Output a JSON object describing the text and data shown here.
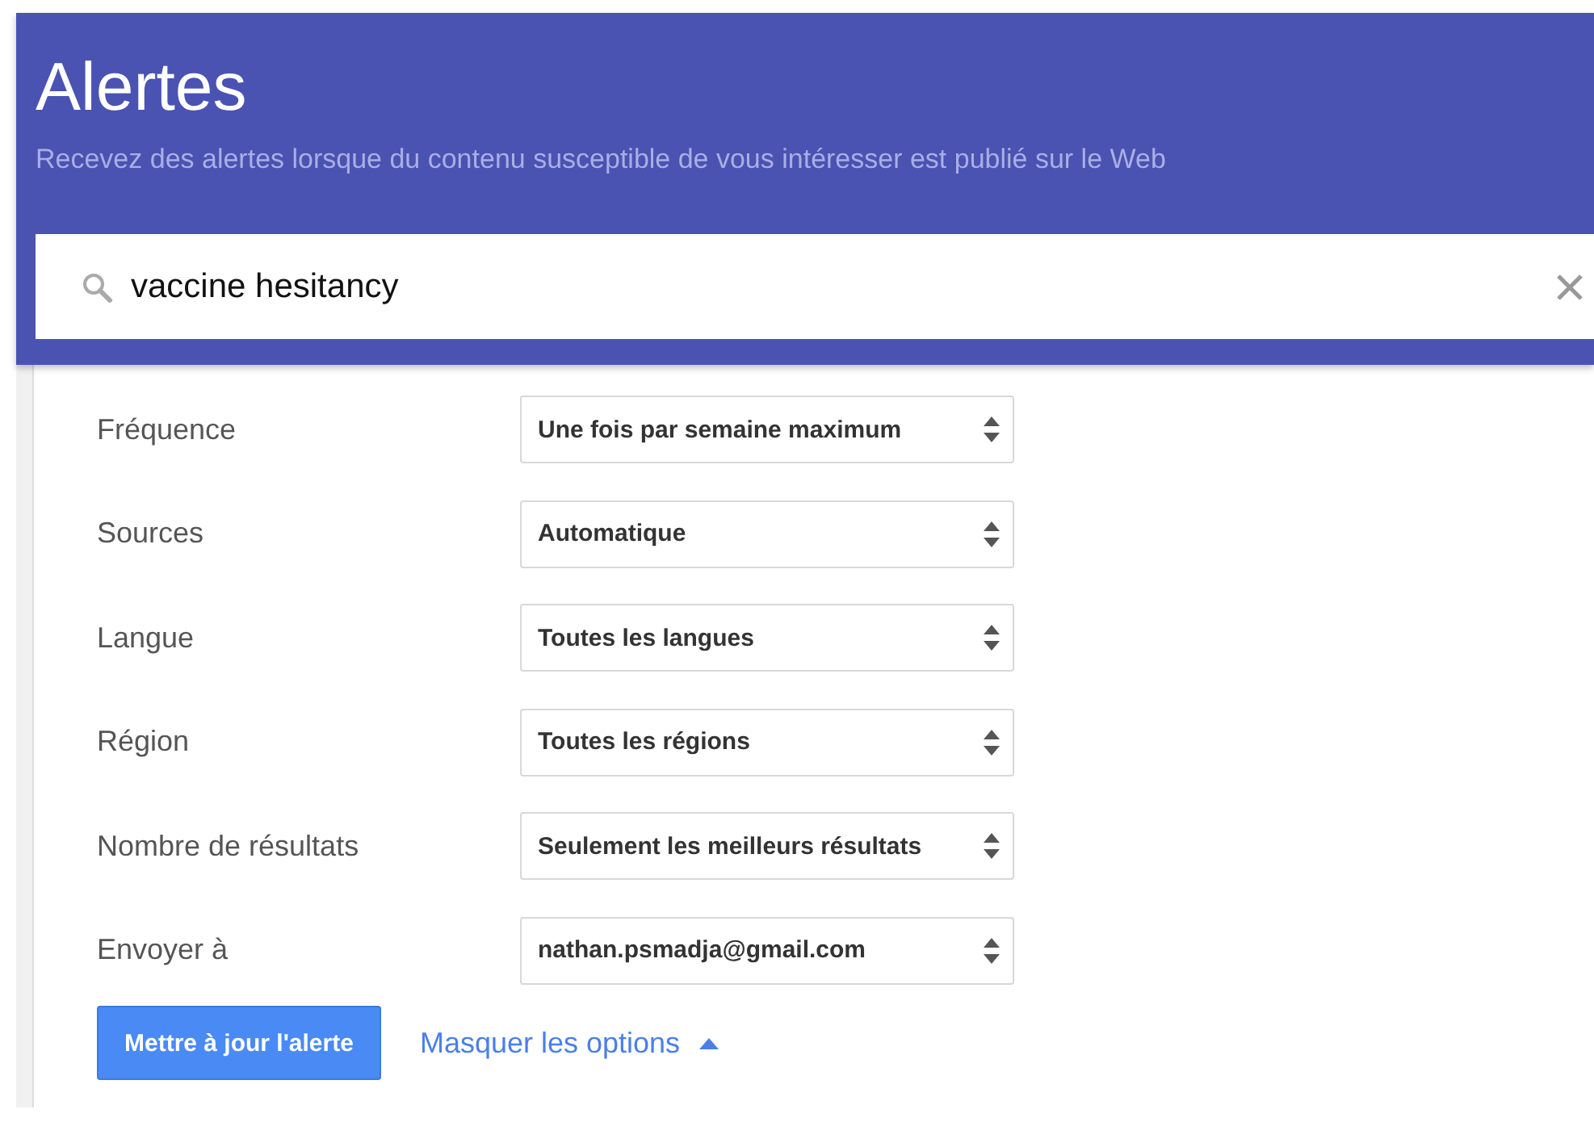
{
  "header": {
    "title": "Alertes",
    "subtitle": "Recevez des alertes lorsque du contenu susceptible de vous intéresser est publié sur le Web"
  },
  "search": {
    "value": "vaccine hesitancy"
  },
  "options": [
    {
      "label": "Fréquence",
      "value": "Une fois par semaine maximum"
    },
    {
      "label": "Sources",
      "value": "Automatique"
    },
    {
      "label": "Langue",
      "value": "Toutes les langues"
    },
    {
      "label": "Région",
      "value": "Toutes les régions"
    },
    {
      "label": "Nombre de résultats",
      "value": "Seulement les meilleurs résultats"
    },
    {
      "label": "Envoyer à",
      "value": "nathan.psmadja@gmail.com"
    }
  ],
  "update_button": "Mettre à jour l'alerte",
  "toggle_link": "Masquer les options"
}
